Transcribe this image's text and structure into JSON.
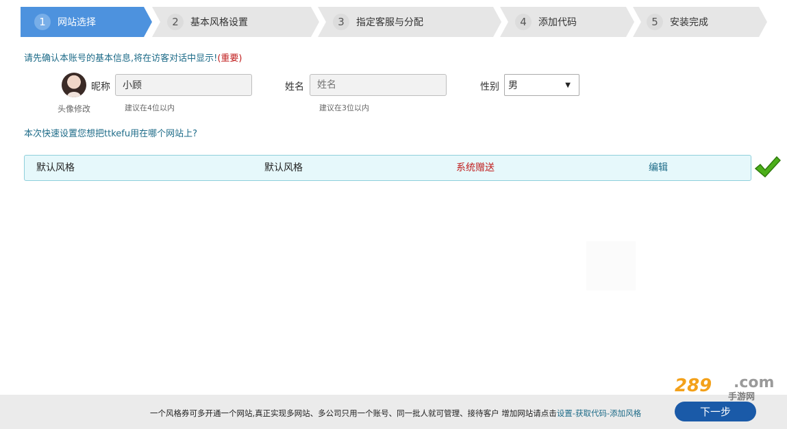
{
  "steps": [
    {
      "num": "1",
      "label": "网站选择"
    },
    {
      "num": "2",
      "label": "基本风格设置"
    },
    {
      "num": "3",
      "label": "指定客服与分配"
    },
    {
      "num": "4",
      "label": "添加代码"
    },
    {
      "num": "5",
      "label": "安装完成"
    }
  ],
  "intro": {
    "text": "请先确认本账号的基本信息,将在访客对话中显示!",
    "important": "(重要)"
  },
  "profile": {
    "avatar_edit": "头像修改",
    "nickname_label": "昵称",
    "nickname_value": "小顾",
    "nickname_hint": "建议在4位以内",
    "name_label": "姓名",
    "name_placeholder": "姓名",
    "name_hint": "建议在3位以内",
    "gender_label": "性别",
    "gender_value": "男"
  },
  "question": "本次快速设置您想把ttkefu用在哪个网站上?",
  "site_row": {
    "name": "默认风格",
    "style": "默认风格",
    "status": "系统赠送",
    "edit": "编辑"
  },
  "footer": {
    "notice": "一个风格券可多开通一个网站,真正实现多网站、多公司只用一个账号、同一批人就可管理、接待客户 增加网站请点击",
    "link": "设置-获取代码-添加风格",
    "next": "下一步"
  },
  "brand": {
    "digits": "289",
    "com": ".com",
    "sub": "手游网"
  },
  "colors": {
    "accent": "#4d92de",
    "button": "#1a5aa8",
    "important": "#c01d1d",
    "link": "#1d6b88",
    "check": "#4caf1a"
  }
}
